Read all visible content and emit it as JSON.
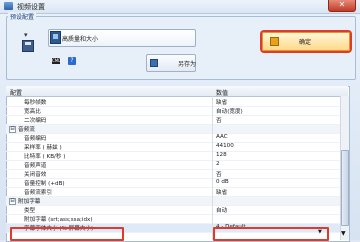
{
  "window": {
    "title": "视频设置",
    "close_symbol": "✕"
  },
  "preset": {
    "legend": "预设配置",
    "selected": "高质量和大小",
    "save_as_label": "另存为",
    "ok_label": "确定",
    "cmd_icon_label": "CMD",
    "help_icon_label": "?"
  },
  "grid": {
    "header_name": "配置",
    "header_value": "数值",
    "rows": [
      {
        "name": "每秒帧数",
        "value": "缺省",
        "indent": 2
      },
      {
        "name": "宽高比",
        "value": "自动(宽度)",
        "indent": 2
      },
      {
        "name": "二次编码",
        "value": "否",
        "indent": 2
      },
      {
        "name": "音频流",
        "value": "",
        "indent": 1,
        "category": true,
        "expander": "⊟"
      },
      {
        "name": "音频编码",
        "value": "AAC",
        "indent": 2
      },
      {
        "name": "采样率 ( 赫兹 )",
        "value": "44100",
        "indent": 2
      },
      {
        "name": "比特率 ( KB/秒 )",
        "value": "128",
        "indent": 2
      },
      {
        "name": "音频声道",
        "value": "2",
        "indent": 2
      },
      {
        "name": "关闭音效",
        "value": "否",
        "indent": 2
      },
      {
        "name": "音量控制 (+dB)",
        "value": "0 dB",
        "indent": 2
      },
      {
        "name": "音频流索引",
        "value": "缺省",
        "indent": 2
      },
      {
        "name": "附加字幕",
        "value": "",
        "indent": 1,
        "category": true,
        "expander": "⊟"
      },
      {
        "name": "类型",
        "value": "自动",
        "indent": 2
      },
      {
        "name": "附加字幕 (srt;ass;ssa;idx)",
        "value": "",
        "indent": 2
      },
      {
        "name": "字幕字体大小 (% 屏幕大小)",
        "value": "4 - Default",
        "indent": 2,
        "selected": true
      }
    ]
  },
  "colors": {
    "highlight": "#e23a2a",
    "ok_button": "#ffd98a"
  }
}
